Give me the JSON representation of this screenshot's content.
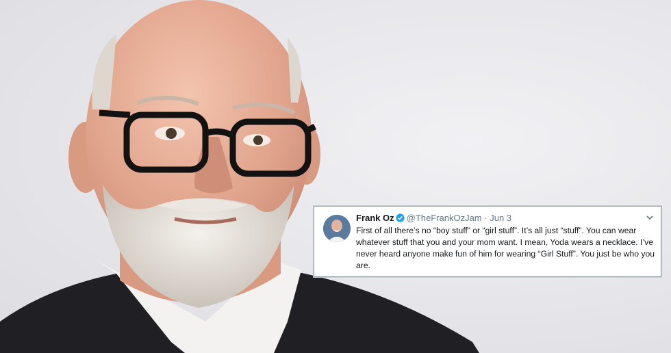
{
  "photo": {
    "subject_icon": "portrait-photo",
    "background_color": "#e9e9ed"
  },
  "tweet": {
    "author_name": "Frank Oz",
    "handle": "@TheFrankOzJam",
    "separator": "·",
    "date": "Jun 3",
    "text": "First of all there’s no “boy stuff” or “girl stuff”. It’s all just “stuff”. You can wear whatever stuff that you and your mom want. I mean, Yoda wears a necklace. I’ve never heard anyone make fun of him for wearing “Girl Stuff”.  You just be who you are.",
    "verified_icon": "verified-badge-icon",
    "menu_icon": "chevron-down-icon",
    "accent_color": "#1da1f2"
  }
}
